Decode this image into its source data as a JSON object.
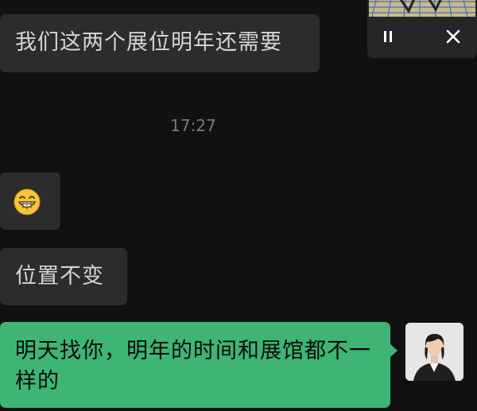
{
  "chat": {
    "messages": [
      {
        "side": "incoming",
        "text": "我们这两个展位明年还需要"
      },
      {
        "side": "incoming",
        "emoji": "grinning-face-emoji"
      },
      {
        "side": "incoming",
        "text": "位置不变"
      },
      {
        "side": "outgoing",
        "text": "明天找你，明年的时间和展馆都不一样的"
      }
    ],
    "timestamp": "17:27"
  },
  "pip": {
    "pause_icon": "pause-icon",
    "close_icon": "close-icon"
  },
  "colors": {
    "background": "#111111",
    "incoming_bubble": "#2c2c2c",
    "outgoing_bubble": "#3eb575",
    "timestamp": "#7a7a7a"
  }
}
